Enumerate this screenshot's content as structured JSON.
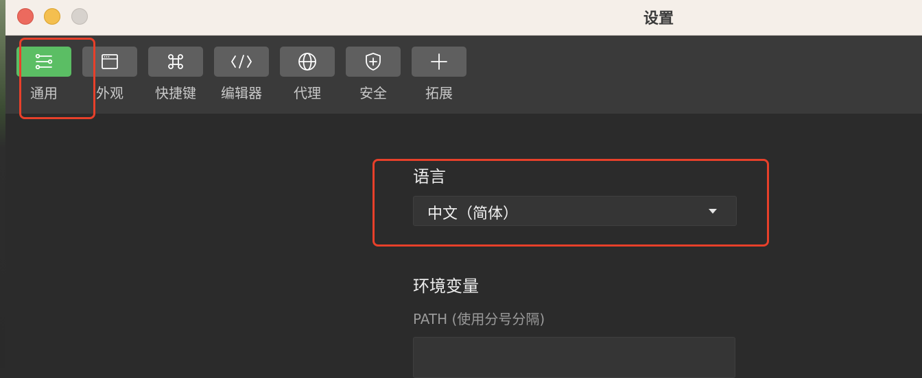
{
  "window": {
    "title": "设置"
  },
  "tabs": [
    {
      "id": "general",
      "label": "通用",
      "icon": "sliders-icon"
    },
    {
      "id": "appearance",
      "label": "外观",
      "icon": "window-icon"
    },
    {
      "id": "shortcuts",
      "label": "快捷键",
      "icon": "command-key-icon"
    },
    {
      "id": "editor",
      "label": "编辑器",
      "icon": "code-icon"
    },
    {
      "id": "proxy",
      "label": "代理",
      "icon": "globe-icon"
    },
    {
      "id": "security",
      "label": "安全",
      "icon": "shield-plus-icon"
    },
    {
      "id": "extensions",
      "label": "拓展",
      "icon": "plus-icon"
    }
  ],
  "active_tab": "general",
  "language": {
    "title": "语言",
    "selected": "中文（简体）"
  },
  "env": {
    "title": "环境变量",
    "path_label": "PATH (使用分号分隔)",
    "path_value": ""
  },
  "colors": {
    "active_tab": "#5bbe64",
    "highlight": "#e8402a",
    "background": "#2b2b2b"
  }
}
